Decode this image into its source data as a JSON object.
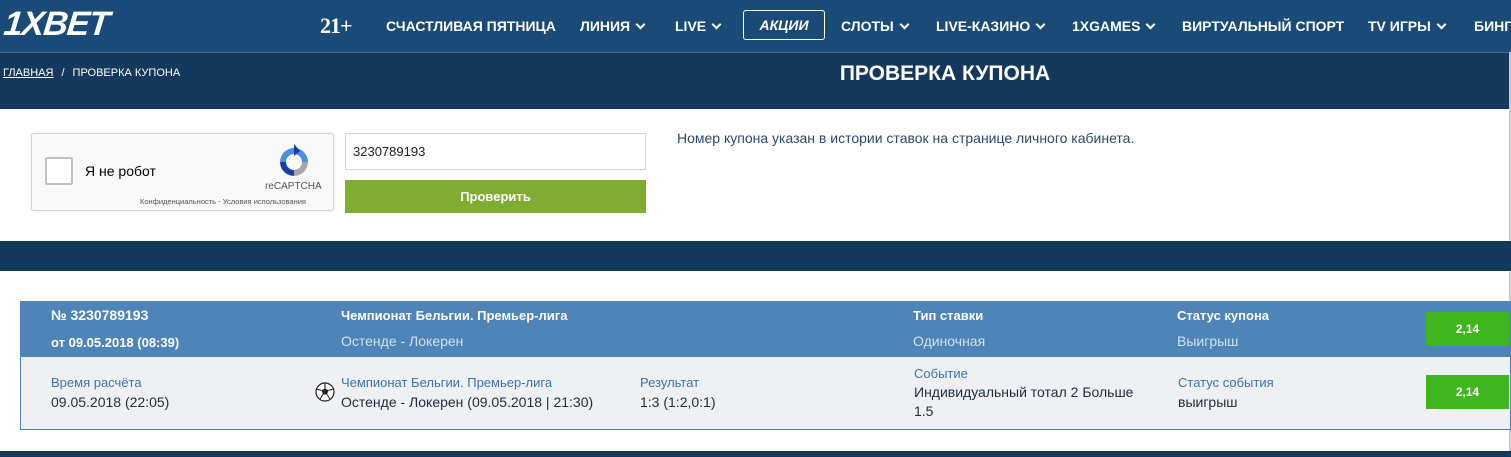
{
  "header": {
    "logo": "1XBET",
    "age_badge": "21+",
    "nav": [
      {
        "label": "СЧАСТЛИВАЯ ПЯТНИЦА"
      },
      {
        "label": "ЛИНИЯ"
      },
      {
        "label": "LIVE"
      },
      {
        "label": "АКЦИИ"
      },
      {
        "label": "СЛОТЫ"
      },
      {
        "label": "LIVE-КАЗИНО"
      },
      {
        "label": "1XGAMES"
      },
      {
        "label": "ВИРТУАЛЬНЫЙ СПОРТ"
      },
      {
        "label": "TV ИГРЫ"
      },
      {
        "label": "БИНГ"
      }
    ]
  },
  "breadcrumb": {
    "home": "ГЛАВНАЯ",
    "separator": "/",
    "current": "ПРОВЕРКА КУПОНА"
  },
  "page_title": "ПРОВЕРКА КУПОНА",
  "recaptcha": {
    "label": "Я не робот",
    "brand": "reCAPTCHA",
    "links": "Конфиденциальность - Условия использования"
  },
  "coupon_form": {
    "input_value": "3230789193",
    "button_label": "Проверить",
    "info": "Номер купона указан в истории ставок на странице личного кабинета."
  },
  "coupon": {
    "number": "№ 3230789193",
    "date": "от 09.05.2018 (08:39)",
    "league": "Чемпионат Бельгии. Премьер-лига",
    "match": "Остенде - Локерен",
    "bet_type_label": "Тип ставки",
    "bet_type": "Одиночная",
    "status_label": "Статус купона",
    "status": "Выигрыш",
    "coefficient": "2,14"
  },
  "event": {
    "calc_time_label": "Время расчёта",
    "calc_time": "09.05.2018 (22:05)",
    "league": "Чемпионат Бельгии. Премьер-лига",
    "match": "Остенде - Локерен (09.05.2018 | 21:30)",
    "result_label": "Результат",
    "result": "1:3 (1:2,0:1)",
    "event_label": "Событие",
    "event_line1": "Индивидуальный тотал 2 Больше",
    "event_line2": "1.5",
    "status_label": "Статус события",
    "status": "выигрыш",
    "coefficient": "2,14"
  },
  "colors": {
    "nav_bg": "#1a4a78",
    "title_bg": "#14395d",
    "button_green": "#80ac31",
    "coeff_green": "#3fb51e",
    "coupon_head_bg": "#4e84b8"
  }
}
